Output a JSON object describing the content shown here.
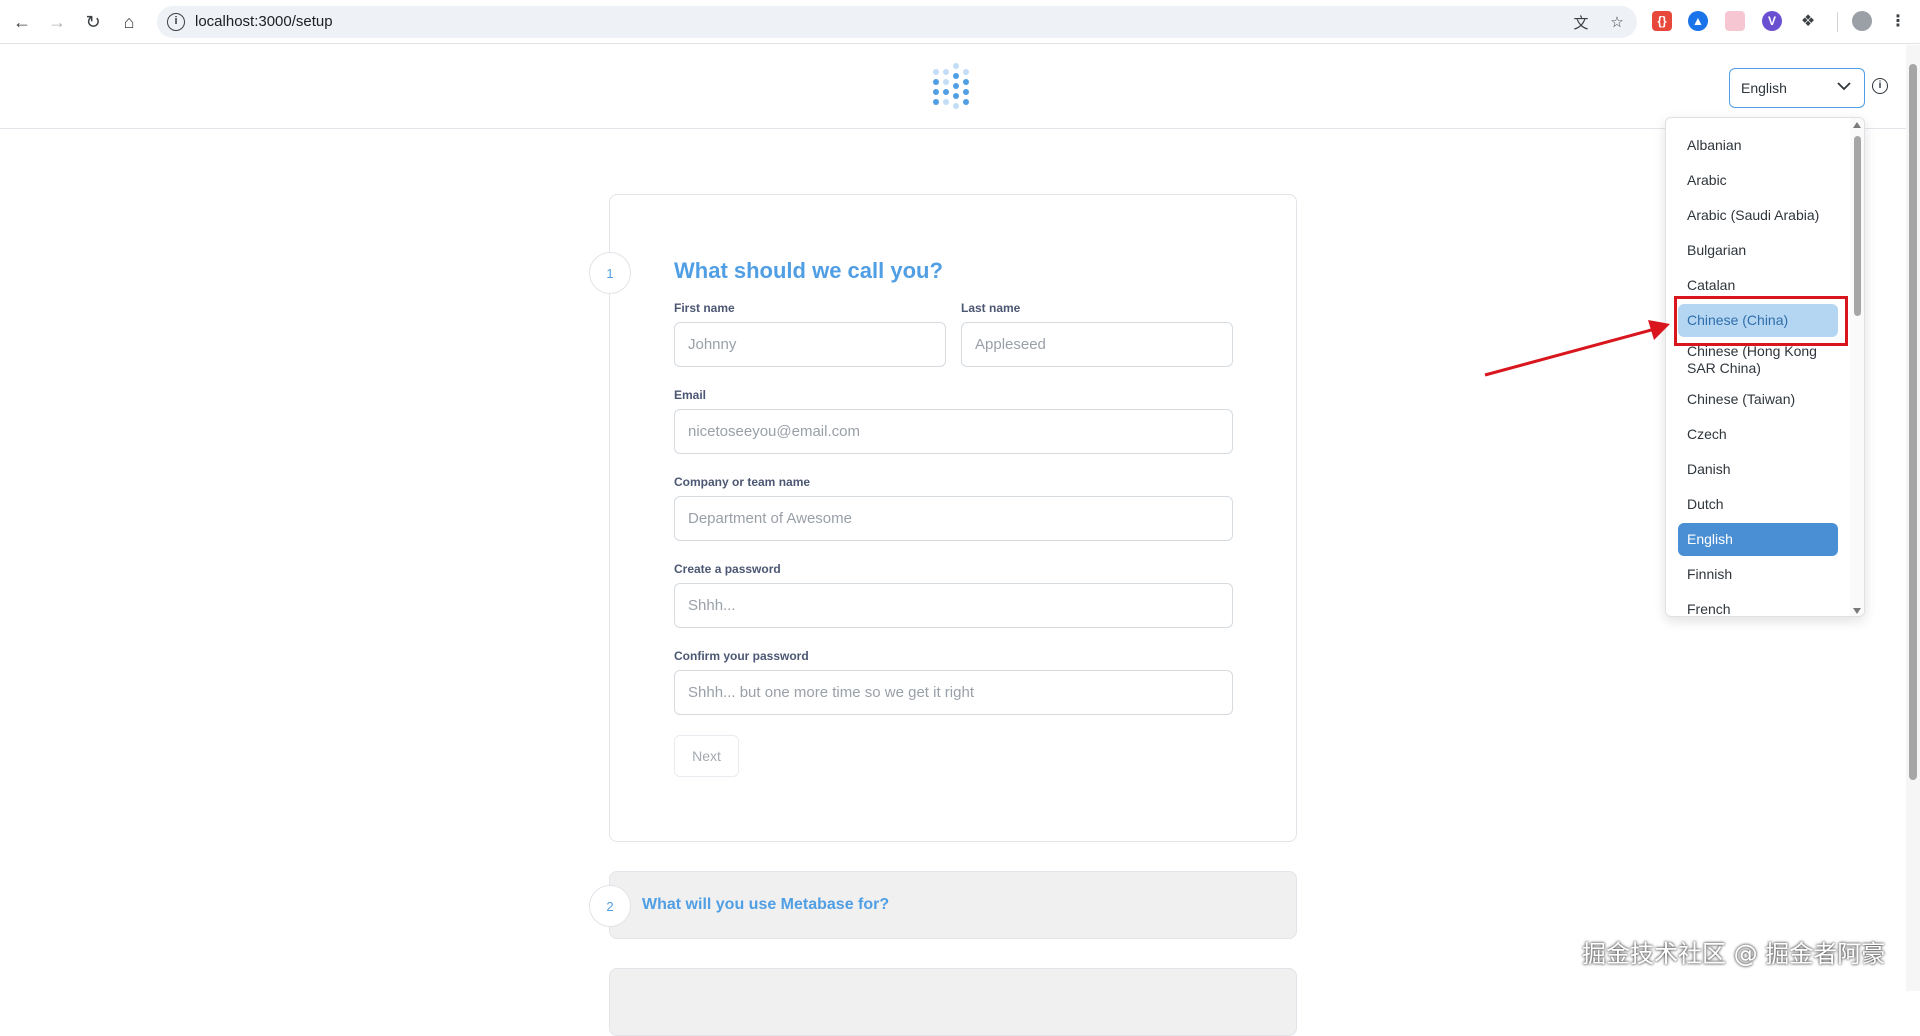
{
  "browser": {
    "url": "localhost:3000/setup"
  },
  "header": {
    "language_selected": "English"
  },
  "language_dropdown": {
    "items": [
      "Albanian",
      "Arabic",
      "Arabic (Saudi Arabia)",
      "Bulgarian",
      "Catalan",
      "Chinese (China)",
      "Chinese (Hong Kong SAR China)",
      "Chinese (Taiwan)",
      "Czech",
      "Danish",
      "Dutch",
      "English",
      "Finnish",
      "French"
    ],
    "hovered": "Chinese (China)",
    "selected": "English"
  },
  "step1": {
    "number": "1",
    "title": "What should we call you?",
    "first_name_label": "First name",
    "first_name_placeholder": "Johnny",
    "last_name_label": "Last name",
    "last_name_placeholder": "Appleseed",
    "email_label": "Email",
    "email_placeholder": "nicetoseeyou@email.com",
    "company_label": "Company or team name",
    "company_placeholder": "Department of Awesome",
    "password_label": "Create a password",
    "password_placeholder": "Shhh...",
    "confirm_label": "Confirm your password",
    "confirm_placeholder": "Shhh... but one more time so we get it right",
    "next_label": "Next"
  },
  "step2": {
    "number": "2",
    "title": "What will you use Metabase for?"
  },
  "watermark": "掘金技术社区 @ 掘金者阿豪",
  "colors": {
    "brand": "#509ee3",
    "selected_item": "#4a8fd4",
    "hovered_item": "#b5d6f3",
    "annotation": "#d9161d"
  }
}
